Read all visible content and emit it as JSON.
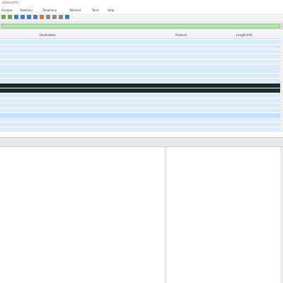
{
  "window": {
    "title": "(Ethernet0)"
  },
  "menu": [
    "Analyze",
    "Statistics",
    "Telephony",
    "Wireless",
    "Tools",
    "Help"
  ],
  "toolbar": {
    "icons": [
      "go-back-icon",
      "go-forward-icon",
      "go-to-packet-icon",
      "first-packet-icon",
      "last-packet-icon",
      "autoscroll-icon",
      "colorize-icon",
      "zoom-in-icon",
      "zoom-out-icon",
      "normal-size-icon",
      "resize-columns-icon"
    ]
  },
  "filter": {
    "value": ""
  },
  "packet_list": {
    "columns": [
      "Destination",
      "Protocol",
      "Length Info"
    ],
    "rows": [
      {
        "source": "",
        "destination": "",
        "protocol": "",
        "info": "",
        "style": "normal"
      },
      {
        "source": "",
        "destination": "",
        "protocol": "",
        "info": "",
        "style": "normal"
      },
      {
        "source": "",
        "destination": "",
        "protocol": "",
        "info": "",
        "style": "normal"
      },
      {
        "source": "",
        "destination": "",
        "protocol": "",
        "info": "",
        "style": "normal"
      },
      {
        "source": "",
        "destination": "",
        "protocol": "",
        "info": "",
        "style": "normal"
      },
      {
        "source": "",
        "destination": "",
        "protocol": "",
        "info": "",
        "style": "normal"
      },
      {
        "source": "",
        "destination": "",
        "protocol": "",
        "info": "",
        "style": "normal"
      },
      {
        "source": "",
        "destination": "",
        "protocol": "",
        "info": "",
        "style": "normal"
      },
      {
        "source": "",
        "destination": "",
        "protocol": "",
        "info": "",
        "style": "normal"
      },
      {
        "source": "",
        "destination": "",
        "protocol": "",
        "info": "",
        "style": "dark"
      },
      {
        "source": "",
        "destination": "",
        "protocol": "",
        "info": "",
        "style": "dark"
      },
      {
        "source": "",
        "destination": "",
        "protocol": "",
        "info": "",
        "style": "normal"
      },
      {
        "source": "",
        "destination": "",
        "protocol": "",
        "info": "",
        "style": "normal"
      },
      {
        "source": "",
        "destination": "",
        "protocol": "",
        "info": "",
        "style": "normal"
      },
      {
        "source": "",
        "destination": "",
        "protocol": "",
        "info": "",
        "style": "normal"
      },
      {
        "source": "",
        "destination": "",
        "protocol": "",
        "info": "",
        "style": "selected"
      },
      {
        "source": "",
        "destination": "",
        "protocol": "",
        "info": "",
        "style": "normal"
      },
      {
        "source": "",
        "destination": "",
        "protocol": "",
        "info": "",
        "style": "normal"
      },
      {
        "source": "",
        "destination": "",
        "protocol": "",
        "info": "",
        "style": "normal"
      }
    ]
  },
  "details": {
    "lines": []
  },
  "bytes": {
    "lines": []
  },
  "colors": {
    "filter_bg": "#aaf0a0",
    "row_bg": "#dcebfb",
    "row_dark": "#1e2b2b",
    "row_dark_text": "#cfeee0",
    "row_selected": "#bfe0ff",
    "hex_highlight": "#5b9bd5"
  }
}
